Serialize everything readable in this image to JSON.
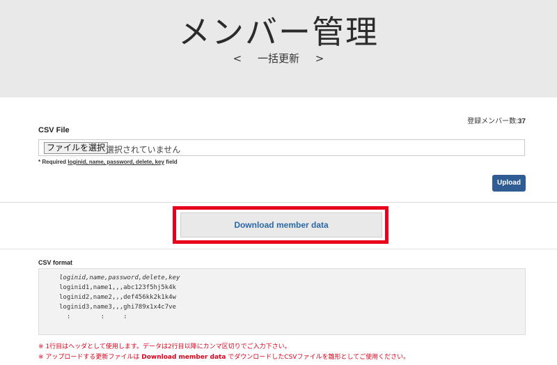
{
  "header": {
    "title": "メンバー管理",
    "subnav": {
      "prev": "<",
      "label": "一括更新",
      "next": ">"
    }
  },
  "member_count": {
    "label": "登録メンバー数:",
    "value": "37"
  },
  "upload_form": {
    "csv_file_label": "CSV File",
    "choose_file_button": "ファイルを選択",
    "file_status": "選択されていません",
    "required_prefix": "* Required",
    "required_fields": "loginid, name, password, delete, key",
    "required_suffix": "field",
    "upload_button": "Upload"
  },
  "download": {
    "button_label": "Download member data",
    "highlight_color": "#e8001c"
  },
  "csv_format": {
    "label": "CSV format",
    "lines": [
      "loginid,name,password,delete,key",
      "loginid1,name1,,,abc123f5hj5k4k",
      "loginid2,name2,,,def456kk2k1k4w",
      "loginid3,name3,,,ghi789x1x4c7ve",
      "  :        :     :"
    ]
  },
  "notes": {
    "note1_a": "※ 1行目はヘッダとして使用します。データは2行目以降にカンマ区切りでご入力下さい。",
    "note2_a": "※ アップロードする更新ファイルは ",
    "note2_b": "Download member data",
    "note2_c": " でダウンロードしたCSVファイルを雛形としてご使用ください。"
  },
  "colors": {
    "header_bg": "#e9e9e9",
    "upload_button": "#2f5d93",
    "download_text": "#2b68a6",
    "note_text": "#e0001a"
  }
}
